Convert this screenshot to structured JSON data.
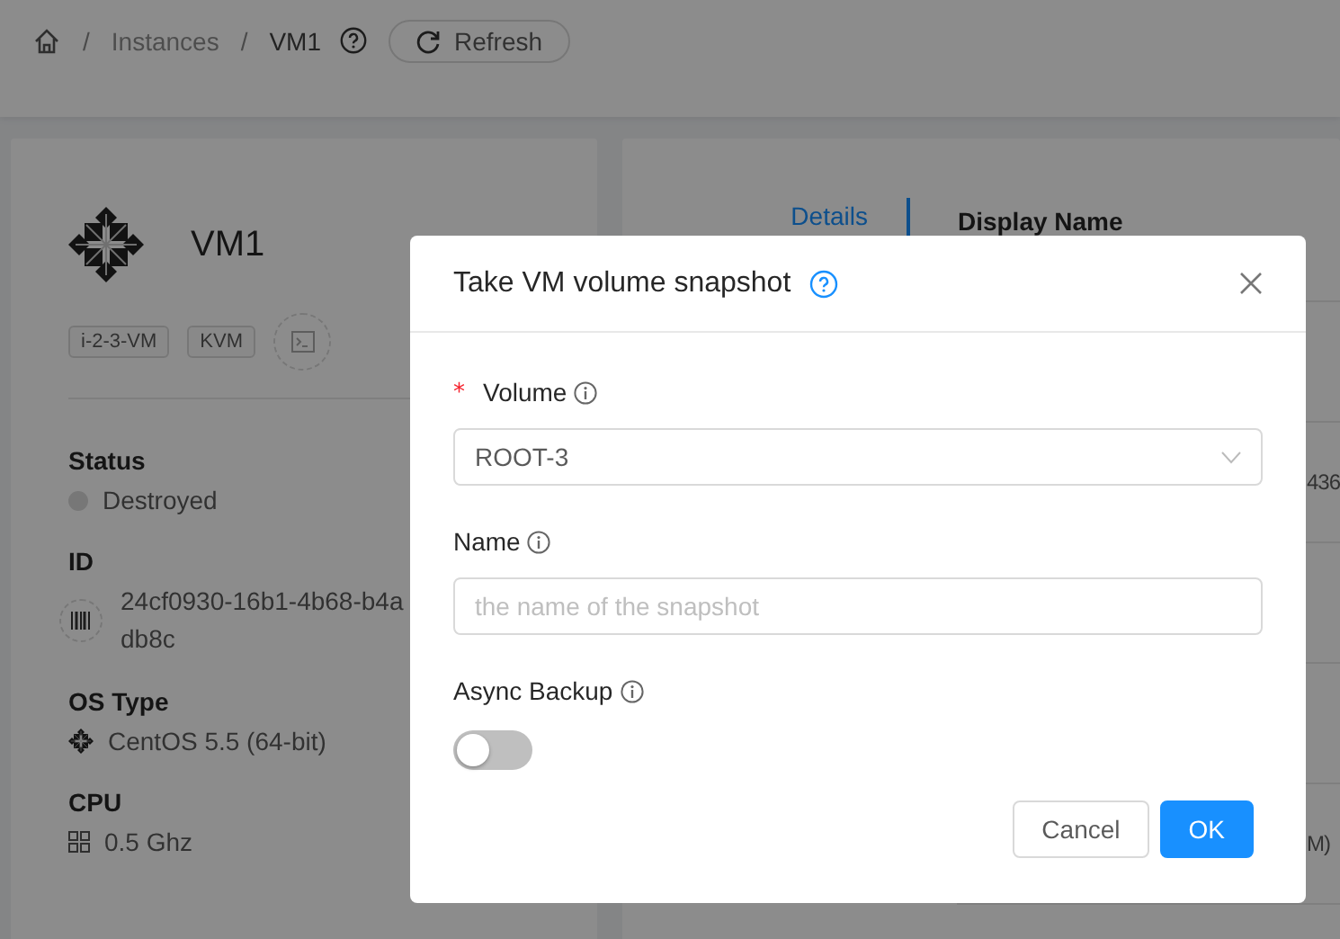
{
  "breadcrumb": {
    "items": [
      {
        "separator": "/",
        "label": "Instances"
      },
      {
        "separator": "/",
        "label": "VM1"
      }
    ],
    "refresh_button": "Refresh"
  },
  "instance_card": {
    "name": "VM1",
    "tags": [
      "i-2-3-VM",
      "KVM"
    ],
    "fields": [
      {
        "kind": "status",
        "label": "Status",
        "value": "Destroyed"
      },
      {
        "kind": "id",
        "label": "ID",
        "lines": [
          "24cf0930-16b1-4b68-b4a",
          "db8c"
        ]
      },
      {
        "kind": "os",
        "label": "OS Type",
        "value": "CentOS 5.5 (64-bit)"
      },
      {
        "kind": "cpu",
        "label": "CPU",
        "value": "0.5 Ghz"
      }
    ]
  },
  "details_panel": {
    "tabs": [
      {
        "label": "Details",
        "selected": true
      }
    ],
    "rows": [
      {
        "label": "Display Name"
      },
      {},
      {
        "value": "436"
      },
      {},
      {},
      {
        "value": "M)"
      }
    ]
  },
  "modal": {
    "title": "Take VM volume snapshot",
    "fields": [
      {
        "kind": "select",
        "label": "Volume",
        "required_mark": "*",
        "value": "ROOT-3"
      },
      {
        "kind": "input",
        "label": "Name",
        "placeholder": "the name of the snapshot"
      },
      {
        "kind": "switch",
        "label": "Async Backup",
        "on": false
      }
    ],
    "buttons": [
      {
        "label": "Cancel",
        "kind": "default"
      },
      {
        "label": "OK",
        "kind": "primary"
      }
    ]
  }
}
